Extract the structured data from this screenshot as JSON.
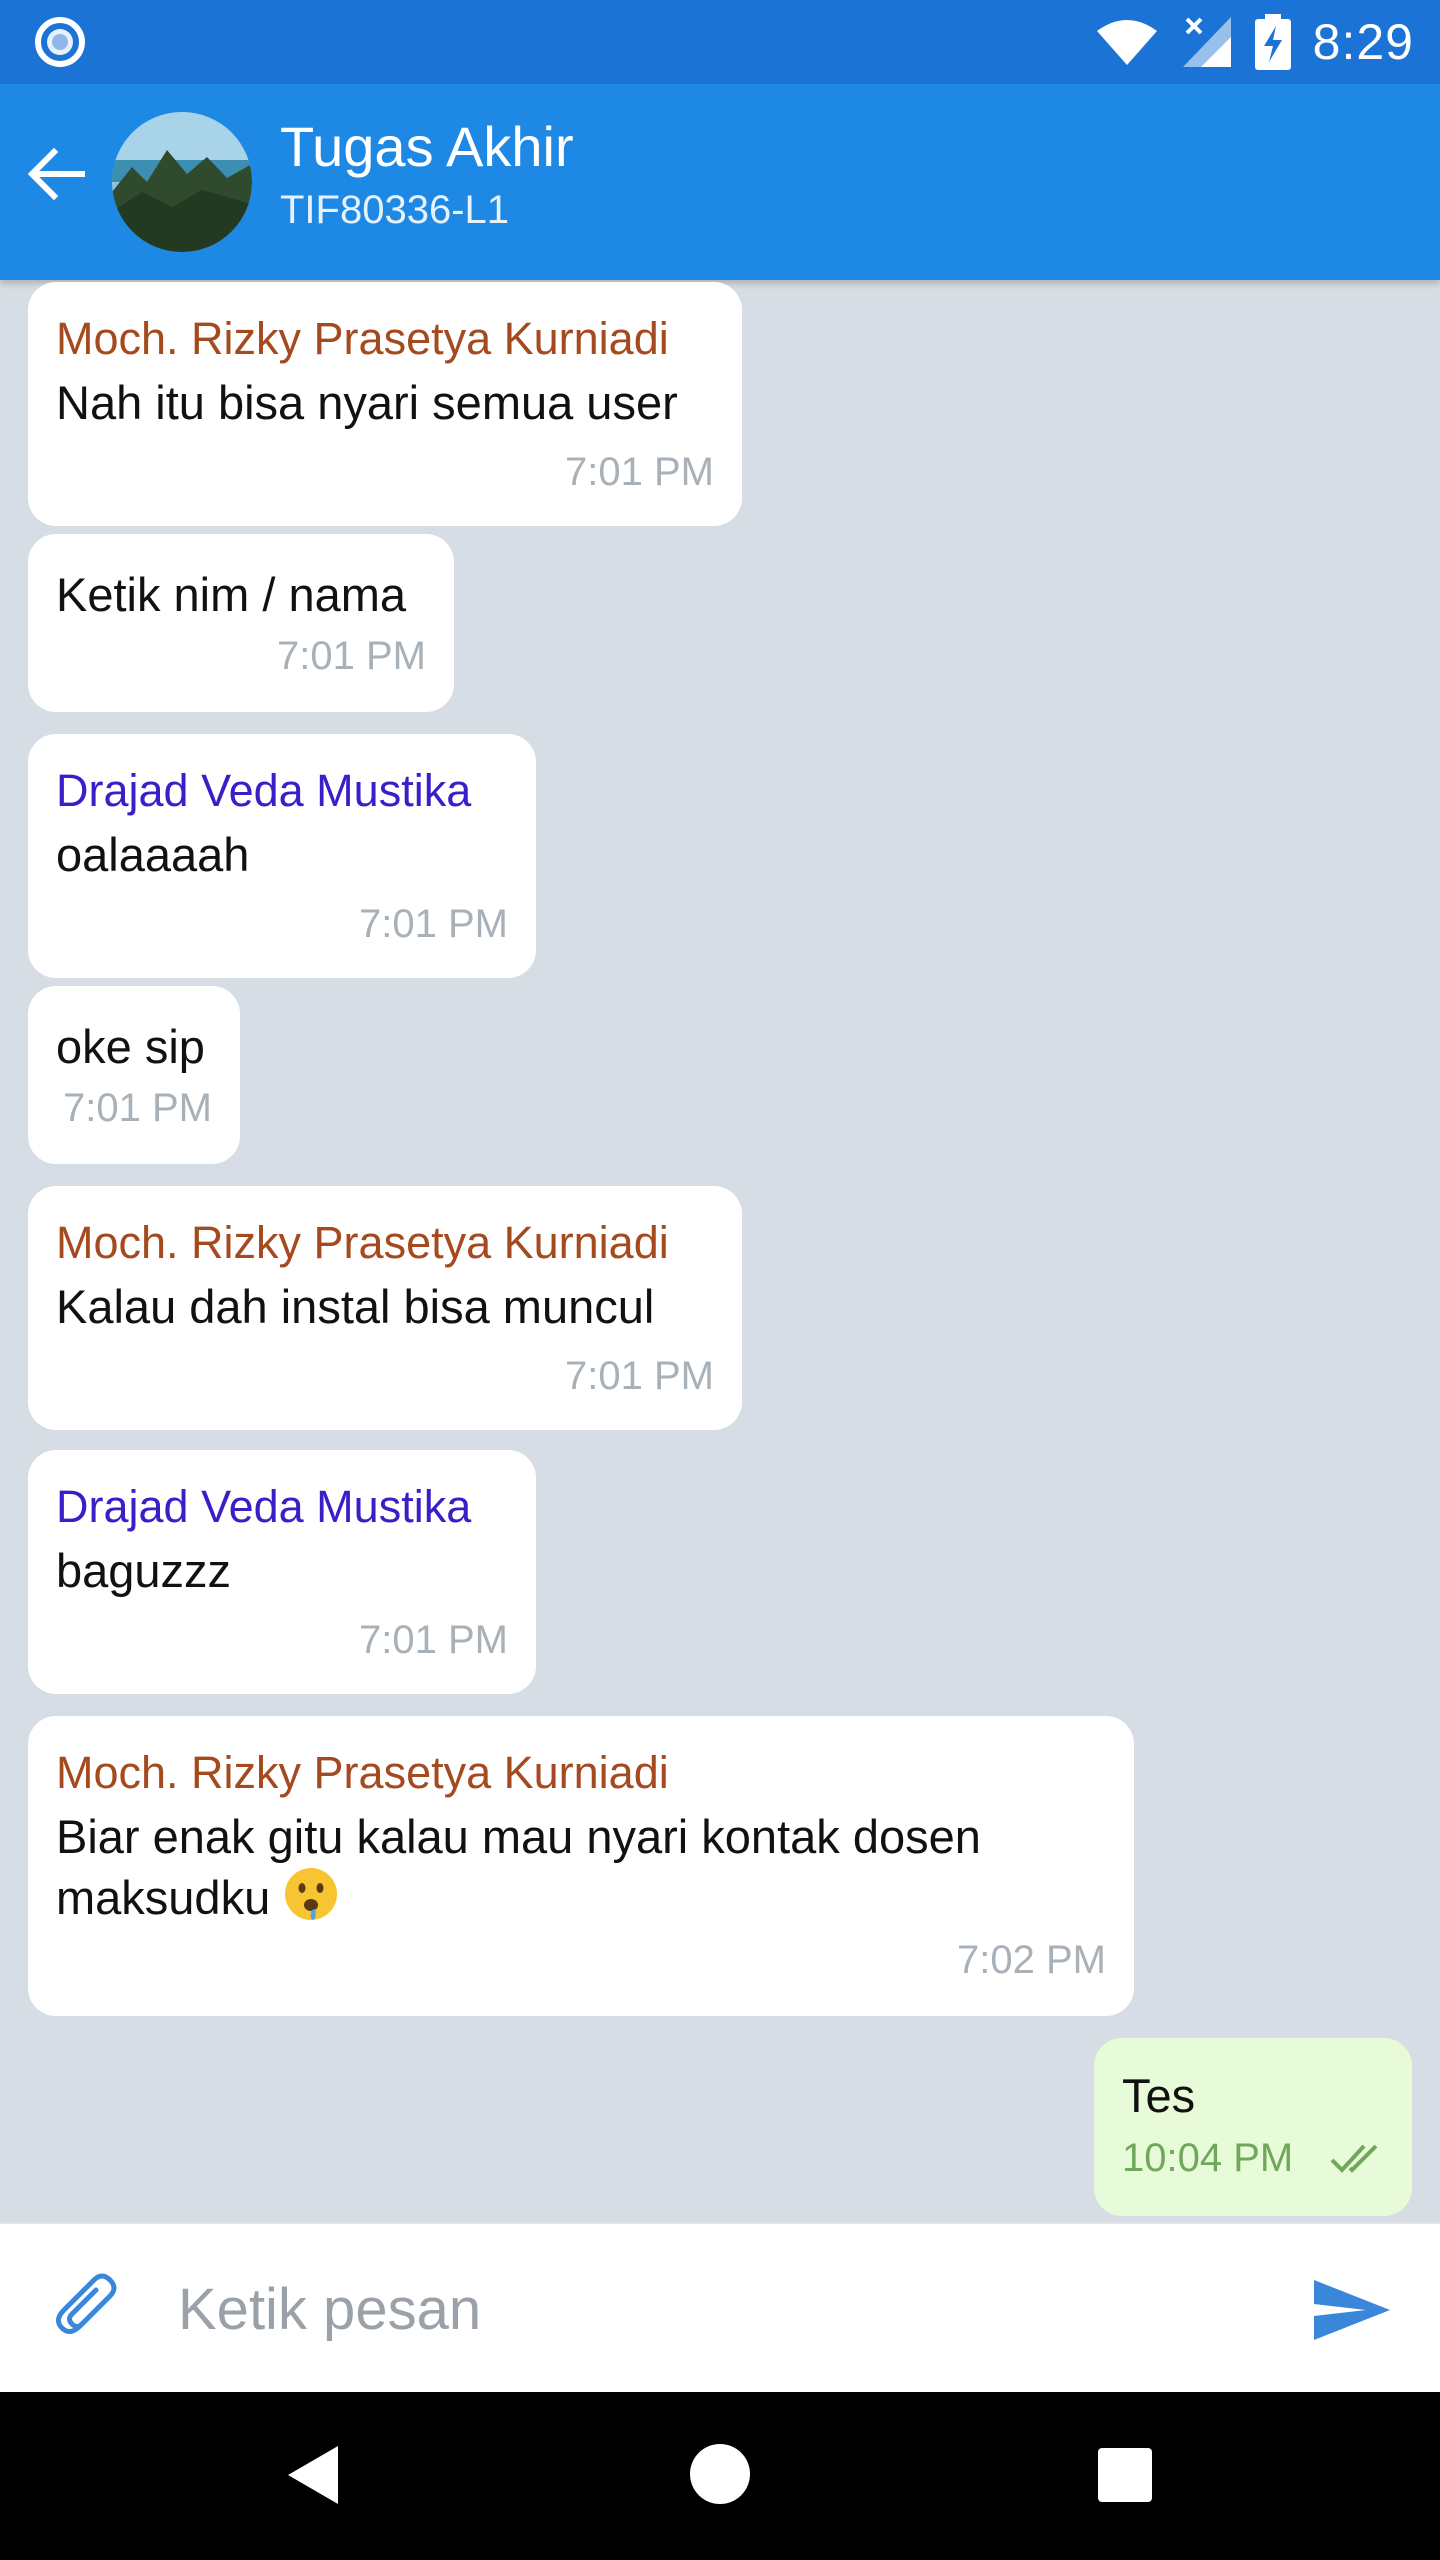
{
  "status_bar": {
    "time": "8:29",
    "icons": [
      "app-notification-icon",
      "wifi-icon",
      "signal-icon",
      "battery-charging-icon"
    ]
  },
  "header": {
    "title": "Tugas Akhir",
    "subtitle": "TIF80336-L1",
    "back_icon": "arrow-left-icon"
  },
  "messages": [
    {
      "sender": "Moch. Rizky Prasetya Kurniadi",
      "text": "Nah itu bisa nyari semua user",
      "time": "7:01 PM"
    },
    {
      "sender": "",
      "text": "Ketik nim / nama",
      "time": "7:01 PM"
    },
    {
      "sender": "Drajad Veda Mustika",
      "text": "oalaaaah",
      "time": "7:01 PM"
    },
    {
      "sender": "",
      "text": "oke sip",
      "time": "7:01 PM"
    },
    {
      "sender": "Moch. Rizky Prasetya Kurniadi",
      "text": "Kalau dah instal bisa muncul",
      "time": "7:01 PM"
    },
    {
      "sender": "Drajad Veda Mustika",
      "text": "baguzzz",
      "time": "7:01 PM"
    },
    {
      "sender": "Moch. Rizky Prasetya Kurniadi",
      "text_line1": "Biar enak gitu kalau mau nyari kontak dosen",
      "text_line2": "maksudku",
      "emoji": "😮",
      "time": "7:02 PM"
    }
  ],
  "outgoing": {
    "text": "Tes",
    "time": "10:04 PM",
    "status_icon": "double-check-icon"
  },
  "composer": {
    "placeholder": "Ketik pesan",
    "attach_icon": "paperclip-icon",
    "send_icon": "send-icon"
  },
  "colors": {
    "status_bar": "#1b73d6",
    "app_bar": "#1e88e5",
    "chat_bg": "#d7dde4",
    "rizky": "#a54a1e",
    "drajad": "#3a1ec8",
    "outgoing_bubble": "#e8fbd8"
  }
}
